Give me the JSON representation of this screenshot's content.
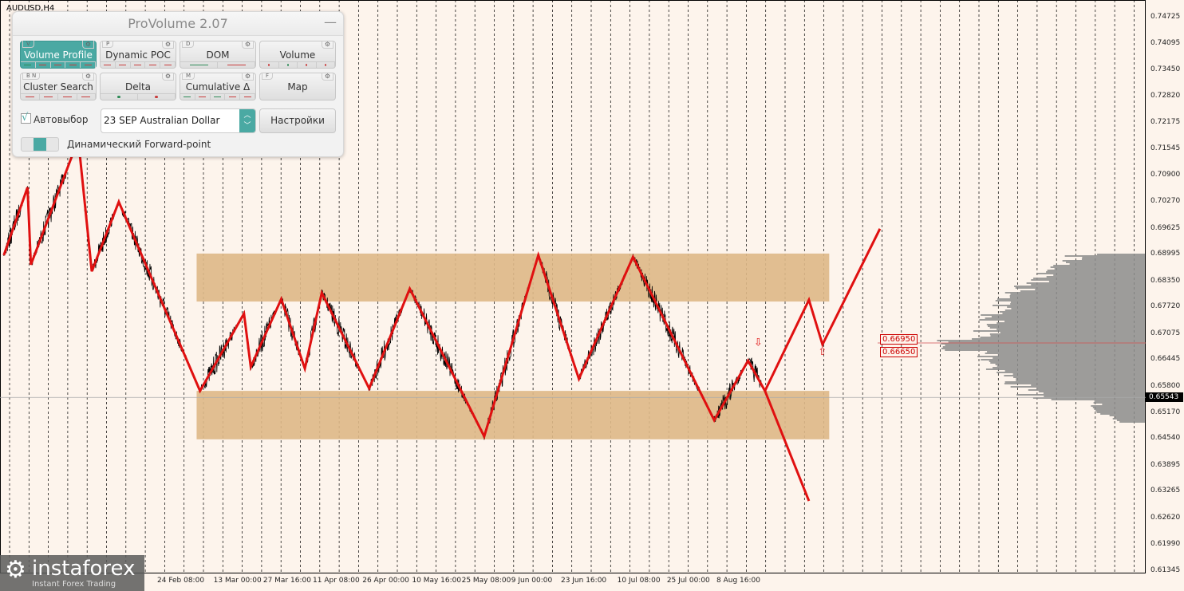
{
  "chart_header": {
    "symbol": "AUDUSD,H4"
  },
  "panel": {
    "title": "ProVolume 2.07",
    "minimize": "—",
    "buttons": [
      {
        "label": "Volume Profile",
        "key": "V",
        "active": true,
        "ind": [
          "g",
          "r",
          "r",
          "r",
          "r"
        ]
      },
      {
        "label": "Dynamic POC",
        "key": "P",
        "active": false,
        "ind": [
          "r",
          "r",
          "r",
          "r",
          "r"
        ]
      },
      {
        "label": "DOM",
        "key": "D",
        "active": false,
        "ind": [
          "g",
          "r"
        ]
      },
      {
        "label": "Volume",
        "key": "",
        "active": false,
        "dots": true,
        "ind": [
          "r",
          "g",
          "r",
          "r"
        ]
      },
      {
        "label": "Cluster Search",
        "key": "B  N",
        "active": false,
        "ind": [
          "r",
          "r",
          "r",
          "r"
        ]
      },
      {
        "label": "Delta",
        "key": "",
        "active": false,
        "dots": true,
        "ind": [
          "g",
          "r"
        ]
      },
      {
        "label": "Cumulative Δ",
        "key": "M",
        "active": false,
        "ind": [
          "g",
          "r",
          "g",
          "r",
          "r"
        ]
      },
      {
        "label": "Map",
        "key": "F",
        "active": false,
        "ind": []
      }
    ],
    "autoselect_label": "Автовыбор",
    "autoselect_checked": true,
    "instrument_select": "23 SEP Australian Dollar",
    "settings_button": "Настройки",
    "forward_toggle_label": "Динамический Forward-point"
  },
  "logo": {
    "name": "instaforex",
    "tagline": "Instant Forex Trading"
  },
  "chart_data": {
    "type": "line",
    "symbol": "AUDUSD",
    "timeframe": "H4",
    "ylim": [
      0.61345,
      0.74725
    ],
    "y_ticks": [
      "0.74725",
      "0.74095",
      "0.73450",
      "0.72820",
      "0.72175",
      "0.71545",
      "0.70900",
      "0.70270",
      "0.69625",
      "0.68995",
      "0.68350",
      "0.67720",
      "0.67075",
      "0.66445",
      "0.65800",
      "0.65170",
      "0.64540",
      "0.63895",
      "0.63265",
      "0.62620",
      "0.61990",
      "0.61345"
    ],
    "x_ticks": [
      {
        "date": "2023-02-24T08:00",
        "label": "24 Feb 08:00"
      },
      {
        "date": "2023-03-13T00:00",
        "label": "13 Mar 00:00"
      },
      {
        "date": "2023-03-27T16:00",
        "label": "27 Mar 16:00"
      },
      {
        "date": "2023-04-11T08:00",
        "label": "11 Apr 08:00"
      },
      {
        "date": "2023-04-26T00:00",
        "label": "26 Apr 00:00"
      },
      {
        "date": "2023-05-10T16:00",
        "label": "10 May 16:00"
      },
      {
        "date": "2023-05-25T08:00",
        "label": "25 May 08:00"
      },
      {
        "date": "2023-06-09T00:00",
        "label": "9 Jun 00:00"
      },
      {
        "date": "2023-06-23T16:00",
        "label": "23 Jun 16:00"
      },
      {
        "date": "2023-07-10T08:00",
        "label": "10 Jul 08:00"
      },
      {
        "date": "2023-07-25T00:00",
        "label": "25 Jul 00:00"
      },
      {
        "date": "2023-08-08T16:00",
        "label": "8 Aug 16:00"
      }
    ],
    "current_price": "0.65543",
    "zigzag": [
      [
        "2023-01-10",
        0.6898
      ],
      [
        "2023-01-17",
        0.7062
      ],
      [
        "2023-01-18",
        0.6875
      ],
      [
        "2023-02-01",
        0.7178
      ],
      [
        "2023-02-05",
        0.6859
      ],
      [
        "2023-02-13",
        0.7027
      ],
      [
        "2023-03-09",
        0.657
      ],
      [
        "2023-03-22",
        0.6757
      ],
      [
        "2023-03-24",
        0.6628
      ],
      [
        "2023-04-02",
        0.6792
      ],
      [
        "2023-04-09",
        0.6624
      ],
      [
        "2023-04-14",
        0.6807
      ],
      [
        "2023-04-28",
        0.6576
      ],
      [
        "2023-05-10",
        0.6817
      ],
      [
        "2023-06-01",
        0.646
      ],
      [
        "2023-06-17",
        0.6898
      ],
      [
        "2023-06-29",
        0.6599
      ],
      [
        "2023-07-15",
        0.6894
      ],
      [
        "2023-08-08",
        0.6499
      ],
      [
        "2023-08-18",
        0.6643
      ],
      [
        "2023-08-23",
        0.657
      ]
    ],
    "forecast_up": [
      [
        "2023-08-23",
        0.657
      ],
      [
        "2023-09-05",
        0.679
      ],
      [
        "2023-09-09",
        0.6682
      ],
      [
        "2023-09-26",
        0.6962
      ]
    ],
    "forecast_down": [
      [
        "2023-08-23",
        0.657
      ],
      [
        "2023-09-05",
        0.6304
      ]
    ],
    "zones": [
      {
        "from": "2023-03-08",
        "to": "2023-09-11",
        "high": 0.6902,
        "low": 0.6786
      },
      {
        "from": "2023-03-08",
        "to": "2023-09-11",
        "high": 0.657,
        "low": 0.6453
      }
    ],
    "levels": [
      {
        "label": "0.66950",
        "value": 0.6695
      },
      {
        "label": "0.66650",
        "value": 0.6665
      }
    ],
    "arrows": [
      {
        "date": "2023-08-21",
        "price": 0.6687,
        "dir": "down"
      },
      {
        "date": "2023-09-09",
        "price": 0.6665,
        "dir": "up"
      }
    ],
    "colors": {
      "zigzag": "#e01010",
      "zone": "#deb887",
      "price": "#000000",
      "profile": "#8c8c8c",
      "background": "#fdf4ec"
    }
  }
}
